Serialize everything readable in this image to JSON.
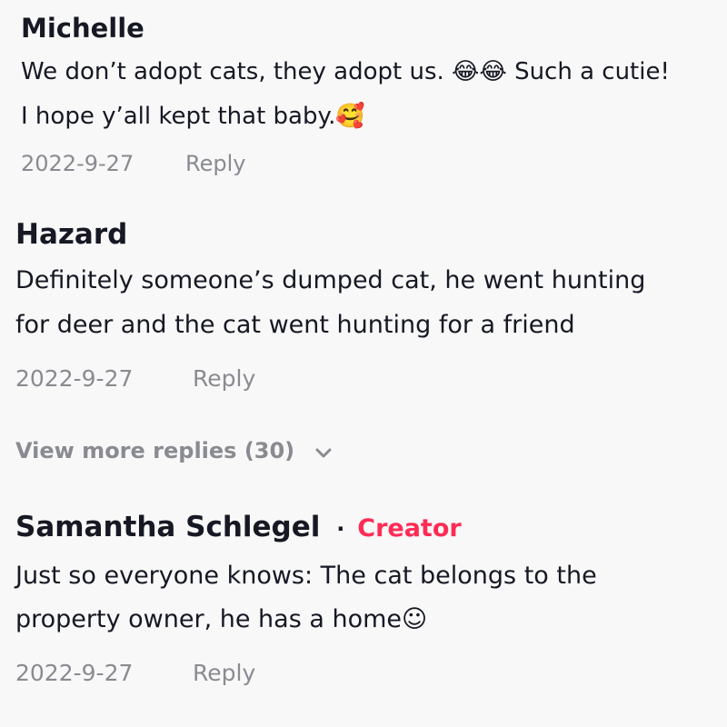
{
  "comments": [
    {
      "author": "Michelle",
      "lines": [
        "We don’t adopt cats, they adopt us. 😂😂 Such a cutie!",
        "I hope y’all kept that baby.🥰"
      ],
      "date": "2022-9-27",
      "reply_label": "Reply"
    },
    {
      "author": "Hazard",
      "lines": [
        "Definitely someone’s dumped cat, he went hunting",
        "for deer and the cat went hunting for a friend"
      ],
      "date": "2022-9-27",
      "reply_label": "Reply"
    },
    {
      "author": "Samantha Schlegel",
      "creator_dot": "·",
      "creator_label": "Creator",
      "lines": [
        "Just so everyone knows: The cat belongs to the",
        "property owner, he has a home☺"
      ],
      "date": "2022-9-27",
      "reply_label": "Reply"
    }
  ],
  "view_more": {
    "label": "View more replies (30)",
    "icon": "chevron-down-icon"
  },
  "colors": {
    "background": "#f8f8f8",
    "text": "#161823",
    "muted": "#8a8b91",
    "creator": "#fe2c55"
  }
}
